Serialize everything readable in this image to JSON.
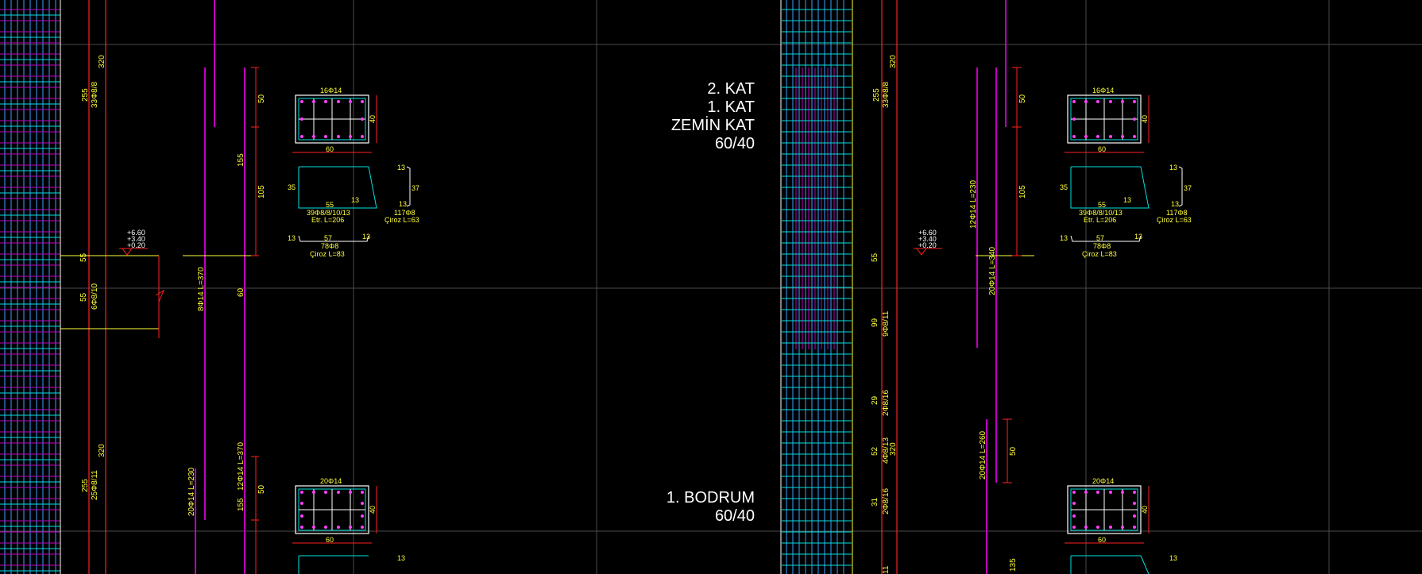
{
  "floor_labels": {
    "upper": [
      "2. KAT",
      "1. KAT",
      "ZEMİN KAT",
      "60/40"
    ],
    "lower": [
      "1. BODRUM",
      "60/40"
    ]
  },
  "left_column": {
    "dims": {
      "d320_top": "320",
      "d255_top": "255",
      "stirrup_top": "33Φ8/8",
      "d55_a": "55",
      "d55_b": "55",
      "stirrup_mid": "6Φ8/10",
      "d320_bot": "320",
      "d255_bot": "255",
      "stirrup_bot": "25Φ8/11"
    },
    "bars": {
      "d50": "50",
      "d155": "155",
      "d105": "105",
      "d60": "60",
      "bar_a": "8Φ14  L=370",
      "bar_b": "20Φ14  L=230",
      "bar_c": "12Φ14  L=370",
      "d155_b": "155",
      "d50_b": "50"
    },
    "levels": [
      "+6.60",
      "+3.40",
      "+0.20"
    ]
  },
  "right_column": {
    "dims": {
      "d320_top": "320",
      "d255_top": "255",
      "stirrup_top": "33Φ8/8",
      "d55": "55",
      "d99": "99",
      "stirrup_a": "9Φ8/11",
      "d29": "29",
      "stirrup_b": "2Φ8/16",
      "d52": "52",
      "stirrup_c": "4Φ8/13",
      "d320_b": "320",
      "d31": "31",
      "stirrup_d": "2Φ8/16",
      "d11": "11"
    },
    "bars": {
      "bar_a": "12Φ14  L=230",
      "bar_b": "20Φ14  L=340",
      "bar_c": "20Φ14  L=260",
      "d50": "50",
      "d105": "105",
      "d50_b": "50",
      "d135": "135"
    },
    "levels": [
      "+6.60",
      "+3.40",
      "+0.20"
    ]
  },
  "section_top": {
    "top_bars": "16Φ14",
    "width": "60",
    "height": "40",
    "stirrup_left": "35",
    "stirrup_len": "55",
    "stirrup_hook": "13",
    "stirrup_label": "39Φ8/8/10/13",
    "stirrup_etr": "Etr. L=206",
    "tie_13a": "13",
    "tie_37": "37",
    "tie_13b": "13",
    "tie_label": "117Φ8",
    "tie_len": "Çiroz L=63",
    "cross_13a": "13",
    "cross_57": "57",
    "cross_13b": "13",
    "cross_label": "78Φ8",
    "cross_len": "Çiroz L=83"
  },
  "section_bottom": {
    "top_bars": "20Φ14",
    "width": "60",
    "height": "40",
    "tie_13": "13"
  }
}
